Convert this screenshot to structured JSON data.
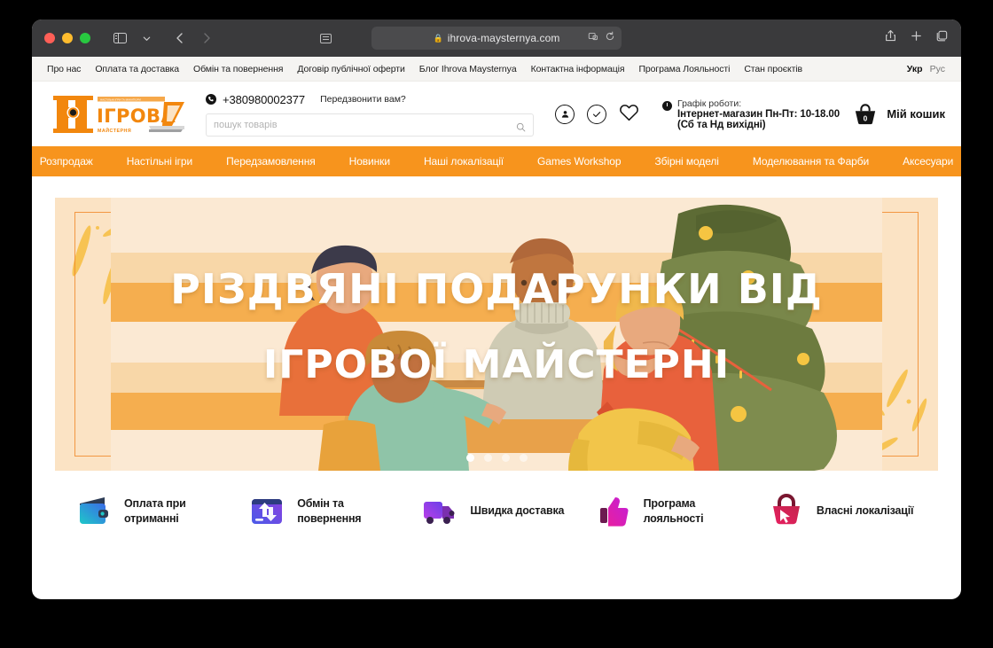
{
  "browser": {
    "url": "ihrova-maysternya.com",
    "lock_icon": "lock-icon",
    "sidebar_icon": "sidebar-toggle-icon",
    "tabs_dropdown_icon": "chevron-down-icon",
    "back_icon": "back-chevron-icon",
    "forward_icon": "forward-chevron-icon",
    "reader_icon": "reader-view-icon",
    "extension_icon": "extensions-icon",
    "reload_icon": "reload-icon",
    "share_icon": "share-icon",
    "newtab_icon": "plus-icon",
    "tabs_icon": "show-tabs-icon"
  },
  "toplinks": {
    "items": [
      {
        "label": "Про нас"
      },
      {
        "label": "Оплата та доставка"
      },
      {
        "label": "Обмін та повернення"
      },
      {
        "label": "Договір публічної оферти"
      },
      {
        "label": "Блог Ihrova Maysternya"
      },
      {
        "label": "Контактна інформація"
      },
      {
        "label": "Програма Лояльності"
      },
      {
        "label": "Стан проєктів"
      }
    ],
    "lang_active": "Укр",
    "lang_other": "Рус"
  },
  "logo": {
    "tagline_top": "НАСТІЛЬНІ ІГРИ ТА МІНІАТЮРИ",
    "word": "ІГРОВА",
    "word_bottom": "МАЙСТЕРНЯ"
  },
  "header": {
    "phone": "+380980002377",
    "callback": "Передзвонити вам?",
    "search_placeholder": "пошук товарів",
    "search_value": "",
    "schedule_title": "Графік роботи:",
    "schedule_line1": "Інтернет-магазин  Пн-Пт: 10-18.00",
    "schedule_line2": "(Сб та Нд вихідні)",
    "cart_count": "0",
    "cart_label": "Мій кошик",
    "account_icon": "user-account-icon",
    "compare_icon": "check-circle-icon",
    "wishlist_icon": "heart-icon",
    "cart_icon": "basket-icon",
    "clock_icon": "clock-icon",
    "phone_icon": "phone-icon",
    "search_icon": "search-icon"
  },
  "nav": {
    "items": [
      {
        "label": "Розпродаж"
      },
      {
        "label": "Настільні ігри"
      },
      {
        "label": "Передзамовлення"
      },
      {
        "label": "Новинки"
      },
      {
        "label": "Наші локалізації"
      },
      {
        "label": "Games Workshop"
      },
      {
        "label": "Збірні моделі"
      },
      {
        "label": "Моделювання та Фарби"
      },
      {
        "label": "Аксесуари"
      }
    ],
    "bg_color": "#F7941D"
  },
  "hero": {
    "line1": "РІЗДВЯНІ ПОДАРУНКИ ВІД",
    "line2": "ІГРОВОЇ МАЙСТЕРНІ",
    "slide_count": 4,
    "active_slide": 1,
    "bg_color": "#FBE3C4",
    "frame_color": "#F08A2B"
  },
  "features": {
    "items": [
      {
        "label": "Оплата при\nотриманні",
        "icon": "wallet-icon"
      },
      {
        "label": "Обмін та\nповернення",
        "icon": "exchange-window-icon"
      },
      {
        "label": "Швидка доставка",
        "icon": "delivery-truck-icon"
      },
      {
        "label": "Програма\nлояльності",
        "icon": "thumbs-up-icon"
      },
      {
        "label": "Власні локалізації",
        "icon": "shopping-bag-cursor-icon"
      }
    ]
  }
}
